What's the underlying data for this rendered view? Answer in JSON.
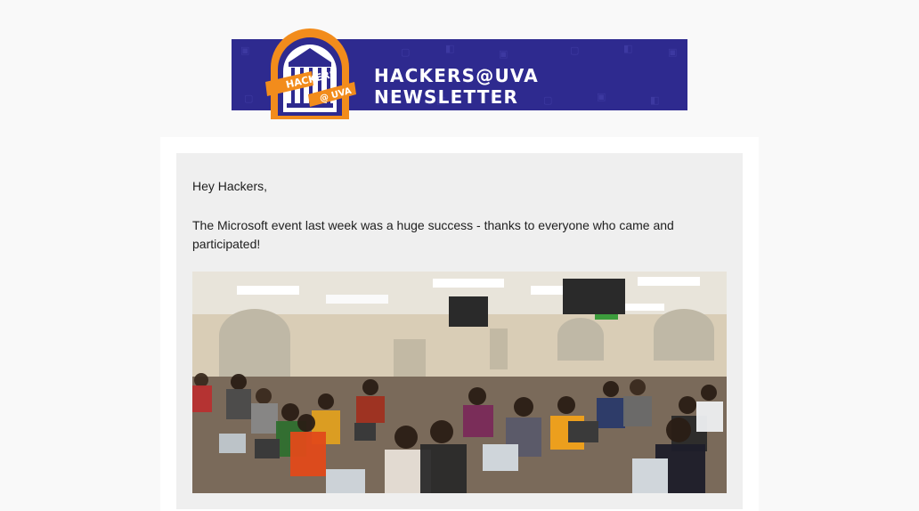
{
  "banner": {
    "title": "HACKERS@UVA NEWSLETTER",
    "logo_text_top": "HACKERS",
    "logo_text_bottom": "@ UVA",
    "colors": {
      "background": "#2e2a8f",
      "logo_orange": "#f28c1c",
      "logo_blue": "#2e2a8f"
    }
  },
  "email": {
    "greeting": "Hey Hackers,",
    "body": "The Microsoft event last week was a huge success - thanks to everyone who came and participated!"
  },
  "photo": {
    "icon": "event-photo"
  }
}
